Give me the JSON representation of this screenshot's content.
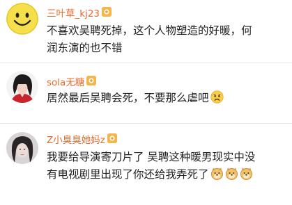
{
  "comments": [
    {
      "username": "三叶草_kj23",
      "lines": [
        "不喜欢吴聘死掉，这个人物塑造的好暖，何",
        "润东演的也不错"
      ],
      "emoji": []
    },
    {
      "username": "sola无糖",
      "lines": [
        "居然最后吴聘会死，不要那么虐吧"
      ],
      "emoji": [
        "sad-face-icon"
      ]
    },
    {
      "username": "Z小臭臭她妈z",
      "lines": [
        "我要给导演寄刀片了 吴聘这种暖男现实中没",
        "有电视剧里出现了你还给我弄死了"
      ],
      "emoji": [
        "doge-icon",
        "doge-icon",
        "doge-icon"
      ]
    }
  ],
  "colors": {
    "username": "#e8692e",
    "text": "#222222",
    "vip_badge": "#f7b44b"
  }
}
